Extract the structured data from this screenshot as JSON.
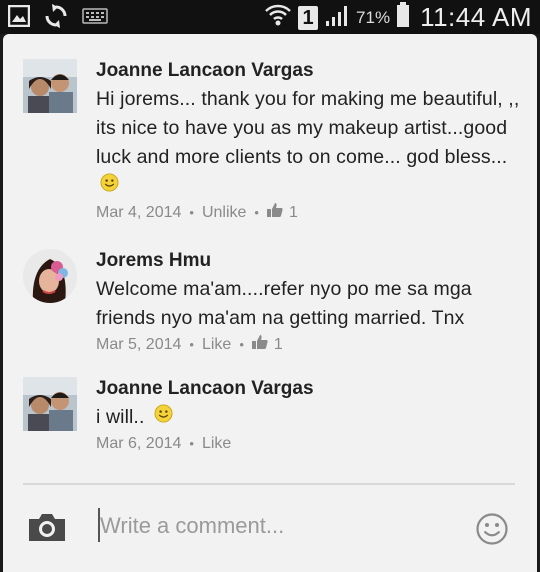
{
  "status_bar": {
    "notification_badge": "1",
    "battery_percent": "71%",
    "time": "11:44 AM"
  },
  "comments": [
    {
      "author": "Joanne Lancaon Vargas",
      "text": "Hi jorems... thank you for making me beautiful, ,, its nice to have you as my makeup artist...good luck and more clients to on come... god bless...",
      "has_smiley": true,
      "date": "Mar 4, 2014",
      "action": "Unlike",
      "likes": "1"
    },
    {
      "author": "Jorems Hmu",
      "text": "Welcome ma'am....refer nyo po me sa mga friends nyo ma'am na getting married. Tnx",
      "date": "Mar 5, 2014",
      "action": "Like",
      "likes": "1"
    },
    {
      "author": "Joanne Lancaon Vargas",
      "text": "i will..",
      "has_smiley": true,
      "date": "Mar 6, 2014",
      "action": "Like"
    }
  ],
  "composer": {
    "placeholder": "Write a comment..."
  },
  "icons": [
    "gallery-icon",
    "sync-icon",
    "keyboard-icon",
    "wifi-icon",
    "signal-icon",
    "battery-icon",
    "camera-icon",
    "emoji-icon",
    "thumbs-up-icon",
    "smiley-icon"
  ],
  "colors": {
    "panel_bg": "#f2f2f2",
    "status_bar_bg": "#111111",
    "meta_text": "#8a8a8a",
    "text": "#222222"
  }
}
